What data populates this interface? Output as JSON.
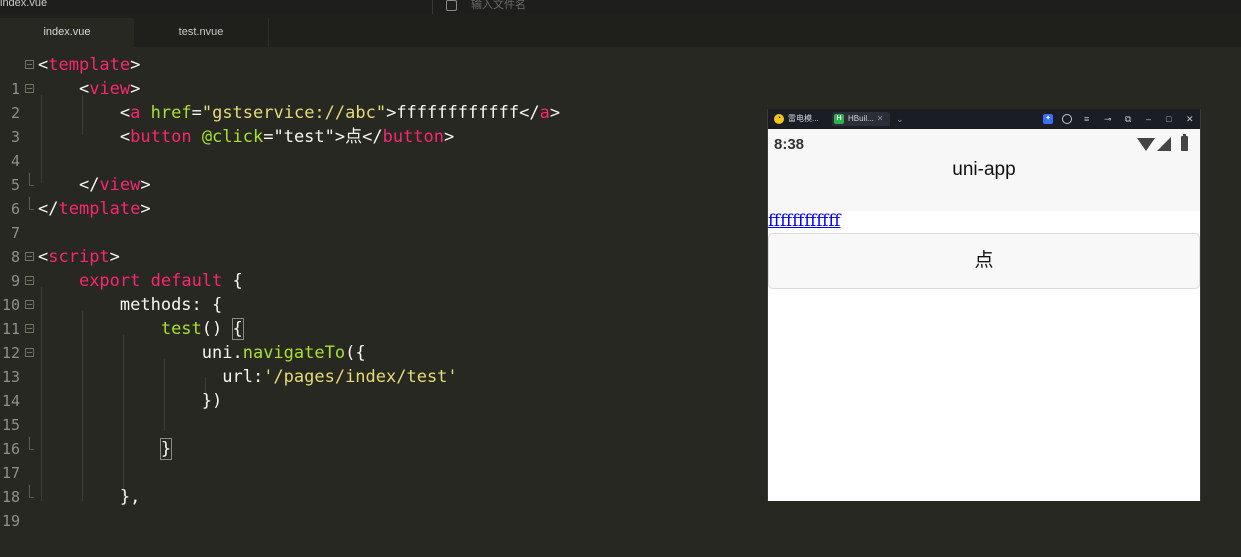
{
  "topbar": {
    "file_label": "index.vue",
    "search_placeholder": "输入文件名"
  },
  "tabs": [
    {
      "label": "index.vue",
      "active": true
    },
    {
      "label": "test.nvue",
      "active": false
    }
  ],
  "editor": {
    "line_numbers": [
      "1",
      "2",
      "3",
      "4",
      "5",
      "6",
      "7",
      "8",
      "9",
      "10",
      "11",
      "12",
      "13",
      "14",
      "15",
      "16",
      "17",
      "18",
      "19"
    ]
  },
  "emulator": {
    "tabs": [
      {
        "label": "雷电模...",
        "icon": "leidian-icon"
      },
      {
        "label": "HBuil...",
        "icon": "hbuilder-icon"
      }
    ],
    "status_time": "8:38",
    "nav_title": "uni-app",
    "link_text": "ffffffffffff",
    "button_label": "点"
  },
  "colors": {
    "editor_bg": "#272822",
    "tag": "#f92672",
    "attribute": "#a6e22e",
    "string": "#e6db74",
    "link": "#0000ee"
  }
}
